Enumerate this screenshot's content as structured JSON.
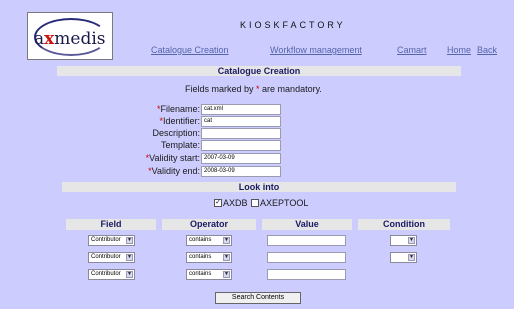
{
  "header": {
    "logo_text_prefix": "a",
    "logo_text_x": "x",
    "logo_text_suffix": "medis",
    "brand": "KIOSKFACTORY",
    "nav": [
      "Catalogue Creation",
      "Workflow management",
      "Camart",
      "Home",
      "Back"
    ]
  },
  "section_title": "Catalogue Creation",
  "mandatory_note": {
    "before": "Fields marked by ",
    "star": "*",
    "after": " are mandatory."
  },
  "form": {
    "filename": {
      "label": "Filename:",
      "value": "cat.xml",
      "required": "*"
    },
    "identifier": {
      "label": "Identifier:",
      "value": "cat",
      "required": "*"
    },
    "description": {
      "label": "Description:",
      "value": ""
    },
    "template": {
      "label": "Template:",
      "value": ""
    },
    "validity_start": {
      "label": "Validity start:",
      "value": "2007-03-09",
      "required": "*"
    },
    "validity_end": {
      "label": "Validity end:",
      "value": "2008-03-09",
      "required": "*"
    }
  },
  "look_into": {
    "title": "Look into",
    "options": [
      {
        "label": "AXDB",
        "checked": "✓"
      },
      {
        "label": "AXEPTOOL",
        "checked": ""
      }
    ]
  },
  "criteria": {
    "headers": [
      "Field",
      "Operator",
      "Value",
      "Condition"
    ],
    "rows": [
      {
        "field": "Contributor",
        "operator": "contains",
        "value": "",
        "condition": ""
      },
      {
        "field": "Contributor",
        "operator": "contains",
        "value": "",
        "condition": ""
      },
      {
        "field": "Contributor",
        "operator": "contains",
        "value": "",
        "condition": null
      }
    ]
  },
  "search_button": "Search Contents",
  "colors": {
    "background": "#ccccff",
    "bar": "#e6e6e6",
    "link": "#5566aa",
    "required": "#cc0000"
  }
}
